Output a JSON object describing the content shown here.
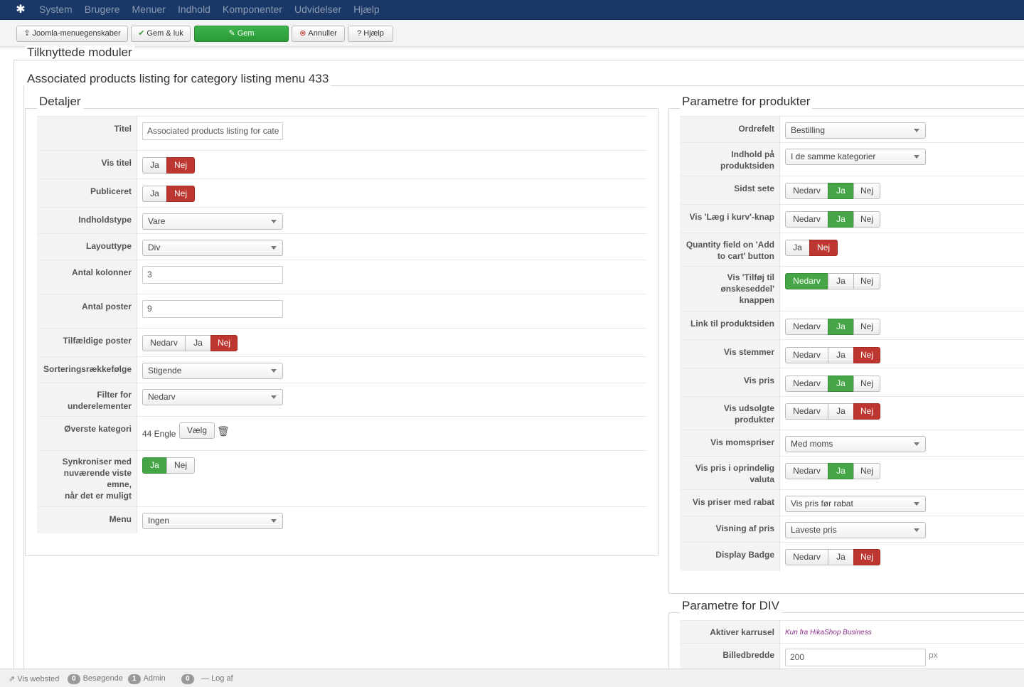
{
  "nav": {
    "items": [
      "System",
      "Brugere",
      "Menuer",
      "Indhold",
      "Komponenter",
      "Udvidelser",
      "Hjælp"
    ]
  },
  "toolbar": {
    "menu_props": "Joomla-menuegenskaber",
    "save_close": "Gem & luk",
    "save": "Gem",
    "cancel": "Annuller",
    "help": "Hjælp"
  },
  "page": {
    "section_title": "Tilknyttede moduler",
    "module_title": "Associated products listing for category listing menu 433"
  },
  "details": {
    "legend": "Detaljer",
    "title_label": "Titel",
    "title_value": "Associated products listing for cate",
    "show_title_label": "Vis titel",
    "published_label": "Publiceret",
    "content_type_label": "Indholdstype",
    "content_type_value": "Vare",
    "layout_type_label": "Layouttype",
    "layout_type_value": "Div",
    "columns_label": "Antal kolonner",
    "columns_value": "3",
    "items_label": "Antal poster",
    "items_value": "9",
    "random_label": "Tilfældige poster",
    "order_dir_label": "Sorteringsrækkefølge",
    "order_dir_value": "Stigende",
    "filter_line1": "Filter for",
    "filter_line2": "underelementer",
    "filter_value": "Nedarv",
    "top_cat_label": "Øverste kategori",
    "top_cat_value": "44 Engle",
    "choose_btn": "Vælg",
    "sync_line1": "Synkroniser med",
    "sync_line2": "nuværende viste",
    "sync_line3": "emne,",
    "sync_line4": "når det er muligt",
    "menu_label": "Menu",
    "menu_value": "Ingen"
  },
  "opts": {
    "ja": "Ja",
    "nej": "Nej",
    "nedarv": "Nedarv"
  },
  "products": {
    "legend": "Parametre for produkter",
    "order_field_label": "Ordrefelt",
    "order_field_value": "Bestilling",
    "content_line1": "Indhold på",
    "content_line2": "produktsiden",
    "content_value": "I de samme kategorier",
    "last_seen_label": "Sidst sete",
    "cart_btn_label": "Vis 'Læg i kurv'-knap",
    "qty_line1": "Quantity field on 'Add",
    "qty_line2": "to cart' button",
    "wish_line1": "Vis 'Tilføj til",
    "wish_line2": "ønskeseddel'",
    "wish_line3": "knappen",
    "link_label": "Link til produktsiden",
    "votes_label": "Vis stemmer",
    "price_label": "Vis pris",
    "soldout_line1": "Vis udsolgte",
    "soldout_line2": "produkter",
    "tax_label": "Vis momspriser",
    "tax_value": "Med moms",
    "orig_line1": "Vis pris i oprindelig",
    "orig_line2": "valuta",
    "discount_label": "Vis priser med rabat",
    "discount_value": "Vis pris før rabat",
    "price_display_label": "Visning af pris",
    "price_display_value": "Laveste pris",
    "badge_label": "Display Badge"
  },
  "div": {
    "legend": "Parametre for DIV",
    "carousel_label": "Aktiver karrusel",
    "carousel_note": "Kun fra HikaShop Business",
    "img_width_label": "Billedbredde",
    "img_width_value": "200",
    "px": "px"
  },
  "status": {
    "view_site": "Vis websted",
    "visitors_count": "0",
    "visitors": "Besøgende",
    "admin_count": "1",
    "admin": "Admin",
    "msg_count": "0",
    "logout": "Log af"
  },
  "colors": {
    "navbar": "#1a3867",
    "active_red": "#bd362f",
    "active_green": "#46a546",
    "save_green": "#2a9a38"
  },
  "icons": [
    "joomla-logo-icon",
    "upload-icon",
    "check-icon",
    "edit-icon",
    "cancel-icon",
    "help-icon",
    "trash-icon",
    "external-link-icon"
  ]
}
